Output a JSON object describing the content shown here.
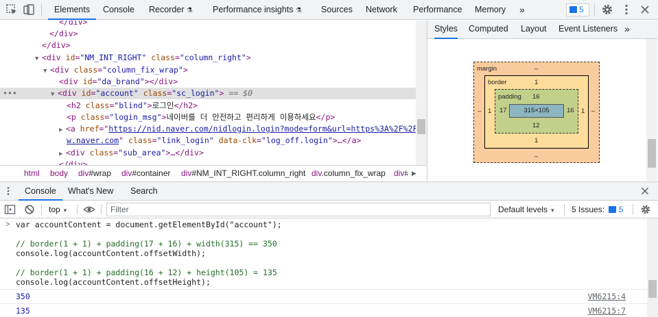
{
  "topbar": {
    "tabs": [
      "Elements",
      "Console",
      "Recorder",
      "Performance insights",
      "Sources",
      "Network",
      "Performance",
      "Memory"
    ],
    "more": "»",
    "issues_count": "5"
  },
  "elements": {
    "lines": [
      {
        "indent": 6,
        "html": "<span class='tag'>&lt;/div&gt;</span>"
      },
      {
        "indent": 4,
        "html": "<span class='tag'>&lt;/div&gt;</span>"
      },
      {
        "indent": 2,
        "html": "<span class='tag'>&lt;/div&gt;</span>"
      }
    ]
  },
  "dom": {
    "l1": "</div>",
    "l2": "</div>",
    "l3": "</div>",
    "l4_tag": "<div",
    "l4_a1": "id",
    "l4_v1": "\"NM_INT_RIGHT\"",
    "l4_a2": "class",
    "l4_v2": "\"column_right\"",
    "l4_end": ">",
    "l5_tag": "<div",
    "l5_a1": "class",
    "l5_v1": "\"column_fix_wrap\"",
    "l5_end": ">",
    "l6_tag": "<div",
    "l6_a1": "id",
    "l6_v1": "\"da_brand\"",
    "l6_end": "></div>",
    "l7_tag": "<div",
    "l7_a1": "id",
    "l7_v1": "\"account\"",
    "l7_a2": "class",
    "l7_v2": "\"sc_login\"",
    "l7_end": ">",
    "l7_ref": "== $0",
    "l8_tag": "<h2",
    "l8_a1": "class",
    "l8_v1": "\"blind\"",
    "l8_open_end": ">",
    "l8_text": "로그인",
    "l8_close": "</h2>",
    "l9_tag": "<p",
    "l9_a1": "class",
    "l9_v1": "\"login_msg\"",
    "l9_open_end": ">",
    "l9_text": "네이버를 더 안전하고 편리하게 이용하세요",
    "l9_close": "</p>",
    "l10_tag": "<a",
    "l10_a1": "href",
    "l10_v1a": "https://nid.naver.com/nidlogin.login?mode=form&url=https%3A%2F%2Fww",
    "l11_v1b": "w.naver.com",
    "l11_a2": "class",
    "l11_v2": "\"link_login\"",
    "l11_a3": "data-clk",
    "l11_v3": "\"log_off.login\"",
    "l11_end": ">…</a>",
    "l12_tag": "<div",
    "l12_a1": "class",
    "l12_v1": "\"sub_area\"",
    "l12_end": ">…</div>",
    "l13": "</div>"
  },
  "breadcrumb": [
    {
      "tag": "html",
      "sel": ""
    },
    {
      "tag": "body",
      "sel": ""
    },
    {
      "tag": "div",
      "sel": "#wrap"
    },
    {
      "tag": "div",
      "sel": "#container"
    },
    {
      "tag": "div",
      "sel": "#NM_INT_RIGHT.column_right"
    },
    {
      "tag": "div",
      "sel": ".column_fix_wrap"
    },
    {
      "tag": "div",
      "sel": "#"
    }
  ],
  "styles": {
    "tabs": [
      "Styles",
      "Computed",
      "Layout",
      "Event Listeners"
    ],
    "more": "»",
    "boxmodel": {
      "margin_label": "margin",
      "margin_top": "–",
      "margin_bottom": "–",
      "margin_left": "–",
      "margin_right": "–",
      "border_label": "border",
      "border_top": "1",
      "border_bottom": "1",
      "border_left": "1",
      "border_right": "1",
      "padding_label": "padding",
      "padding_top": "16",
      "padding_bottom": "12",
      "padding_left": "17",
      "padding_right": "16",
      "content": "315×105"
    }
  },
  "drawer": {
    "tabs": [
      "Console",
      "What's New",
      "Search"
    ]
  },
  "console_toolbar": {
    "context": "top",
    "filter_placeholder": "Filter",
    "levels": "Default levels",
    "issues_label": "5 Issues:",
    "issues_count": "5"
  },
  "console": {
    "input_lines": [
      "var accountContent = document.getElementById(\"account\");",
      "",
      "// border(1 + 1) + padding(17 + 16) + width(315) == 350",
      "console.log(accountContent.offsetWidth);",
      "",
      "// border(1 + 1) + padding(16 + 12) + height(105) = 135",
      "console.log(accountContent.offsetHeight);"
    ],
    "outputs": [
      {
        "value": "350",
        "source": "VM6215:4"
      },
      {
        "value": "135",
        "source": "VM6215:7"
      }
    ]
  }
}
